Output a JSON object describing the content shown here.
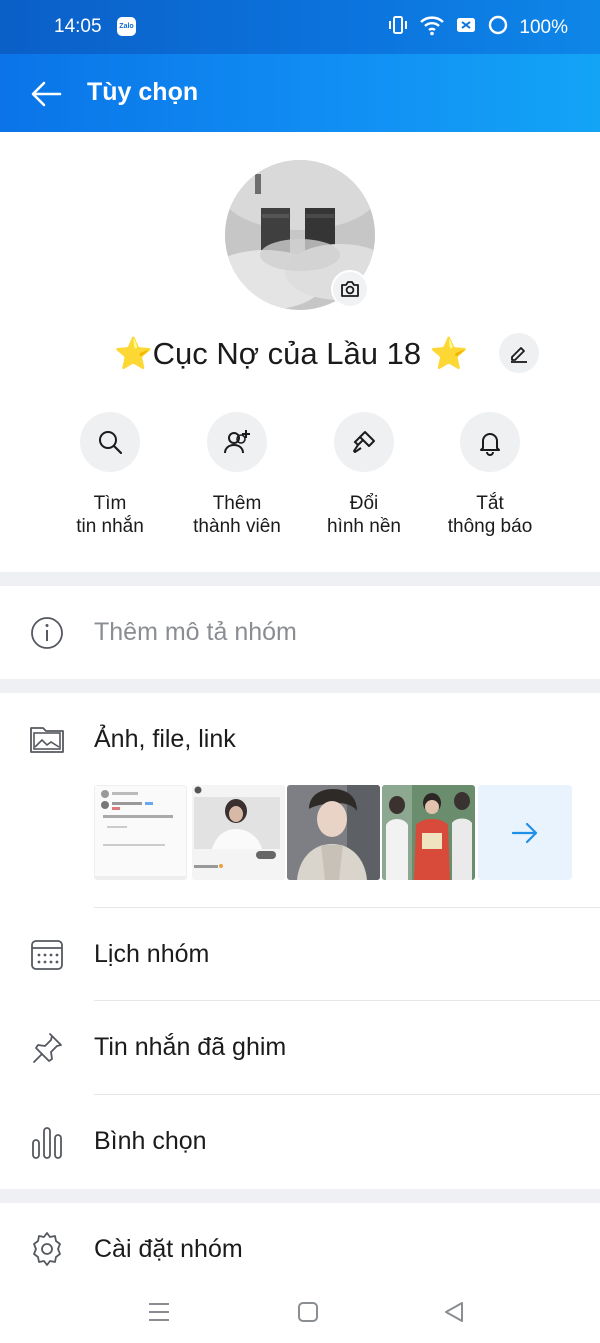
{
  "status_bar": {
    "time": "14:05",
    "notification_app": "Zalo",
    "battery": "100%",
    "icons": [
      "vibrate-icon",
      "wifi-icon",
      "sim-icon",
      "battery-icon"
    ]
  },
  "header": {
    "title": "Tùy chọn",
    "back_icon": "arrow-left-icon",
    "background": "#0a74e8"
  },
  "profile": {
    "group_name": "⭐Cục Nợ của Lầu 18 ⭐",
    "camera_icon": "camera-icon",
    "edit_icon": "pencil-icon"
  },
  "actions": [
    {
      "label": "Tìm\ntin nhắn",
      "icon": "search-icon"
    },
    {
      "label": "Thêm\nthành viên",
      "icon": "add-user-icon"
    },
    {
      "label": "Đổi\nhình nền",
      "icon": "paint-brush-icon"
    },
    {
      "label": "Tắt\nthông báo",
      "icon": "bell-icon"
    }
  ],
  "description": {
    "placeholder": "Thêm mô tả nhóm",
    "icon": "info-icon"
  },
  "media": {
    "title": "Ảnh, file, link",
    "icon": "image-folder-icon",
    "thumb1": {
      "line1": "Lê Đình Lực",
      "line2": "Đặng Thị Như Ý",
      "line3": "Không còn kết dùng"
    },
    "thumb2": {
      "caption": "Tin nhắn"
    },
    "more_icon": "arrow-right-icon"
  },
  "menu": [
    {
      "label": "Lịch nhóm",
      "icon": "calendar-icon"
    },
    {
      "label": "Tin nhắn đã ghim",
      "icon": "pin-icon"
    },
    {
      "label": "Bình chọn",
      "icon": "poll-icon"
    },
    {
      "label": "Cài đặt nhóm",
      "icon": "gear-icon"
    }
  ],
  "navbar": {
    "icons": [
      "menu-icon",
      "home-square-icon",
      "back-triangle-icon"
    ]
  },
  "colors": {
    "accent": "#0a74e8",
    "separator": "#eef0f3",
    "icon_gray": "#55595f",
    "muted_text": "#8a8d92"
  }
}
